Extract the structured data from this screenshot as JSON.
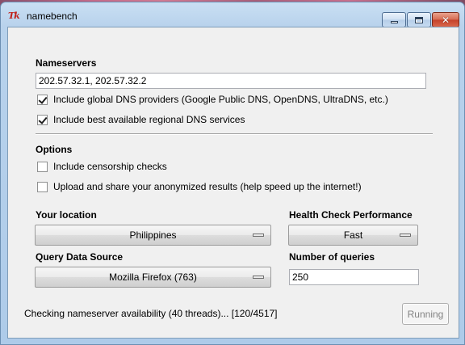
{
  "window": {
    "title": "namebench",
    "icon_label": "Tk",
    "controls": {
      "minimize_icon": "minimize-icon",
      "maximize_icon": "maximize-icon",
      "close_icon": "close-icon",
      "close_glyph": "✕"
    }
  },
  "nameservers": {
    "heading": "Nameservers",
    "value": "202.57.32.1, 202.57.32.2",
    "include_global": {
      "label": "Include global DNS providers (Google Public DNS, OpenDNS, UltraDNS, etc.)",
      "checked": true
    },
    "include_regional": {
      "label": "Include best available regional DNS services",
      "checked": true
    }
  },
  "options": {
    "heading": "Options",
    "censorship": {
      "label": "Include censorship checks",
      "checked": false
    },
    "upload": {
      "label": "Upload and share your anonymized results (help speed up the internet!)",
      "checked": false
    }
  },
  "location": {
    "heading": "Your location",
    "selected": "Philippines"
  },
  "health": {
    "heading": "Health Check Performance",
    "selected": "Fast"
  },
  "data_source": {
    "heading": "Query Data Source",
    "selected": "Mozilla Firefox (763)"
  },
  "queries": {
    "heading": "Number of queries",
    "value": "250"
  },
  "status": {
    "text": "Checking nameserver availability (40 threads)... [120/4517]",
    "button_label": "Running",
    "button_enabled": false
  },
  "colors": {
    "title_bar": "#b8d2ec",
    "client_bg": "#f0f0f0",
    "close_button": "#c4412a",
    "disabled_text": "#838383"
  }
}
